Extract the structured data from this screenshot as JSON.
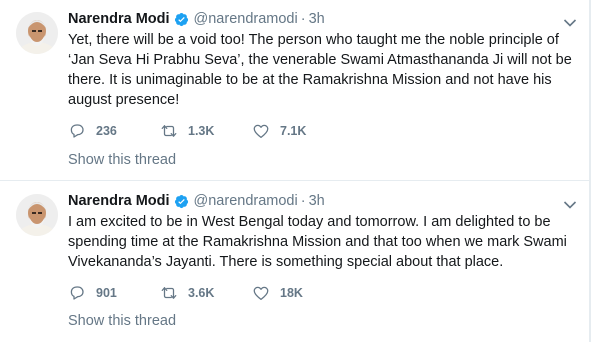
{
  "colors": {
    "text": "#14171a",
    "muted": "#657786",
    "verified": "#1da1f2",
    "divider": "#e6ecf0"
  },
  "tweets": [
    {
      "author_name": "Narendra Modi",
      "handle": "@narendramodi",
      "separator": "·",
      "time": "3h",
      "text": "Yet, there will be a void too! The person who taught me the noble principle of ‘Jan Seva Hi Prabhu Seva’, the venerable Swami Atmasthananda Ji will not be there. It is unimaginable to be at the Ramakrishna Mission and not have his august presence!",
      "replies": "236",
      "retweets": "1.3K",
      "likes": "7.1K",
      "thread_label": "Show this thread"
    },
    {
      "author_name": "Narendra Modi",
      "handle": "@narendramodi",
      "separator": "·",
      "time": "3h",
      "text": "I am excited to be in West Bengal today and tomorrow. I am delighted to be spending time at the Ramakrishna Mission and that too when we mark Swami Vivekananda’s Jayanti. There is something special about that place.",
      "replies": "901",
      "retweets": "3.6K",
      "likes": "18K",
      "thread_label": "Show this thread"
    }
  ],
  "icons": {
    "avatar": "profile-photo",
    "verified": "verified-badge-icon",
    "menu": "chevron-down-icon",
    "reply": "reply-icon",
    "retweet": "retweet-icon",
    "like": "heart-icon"
  }
}
